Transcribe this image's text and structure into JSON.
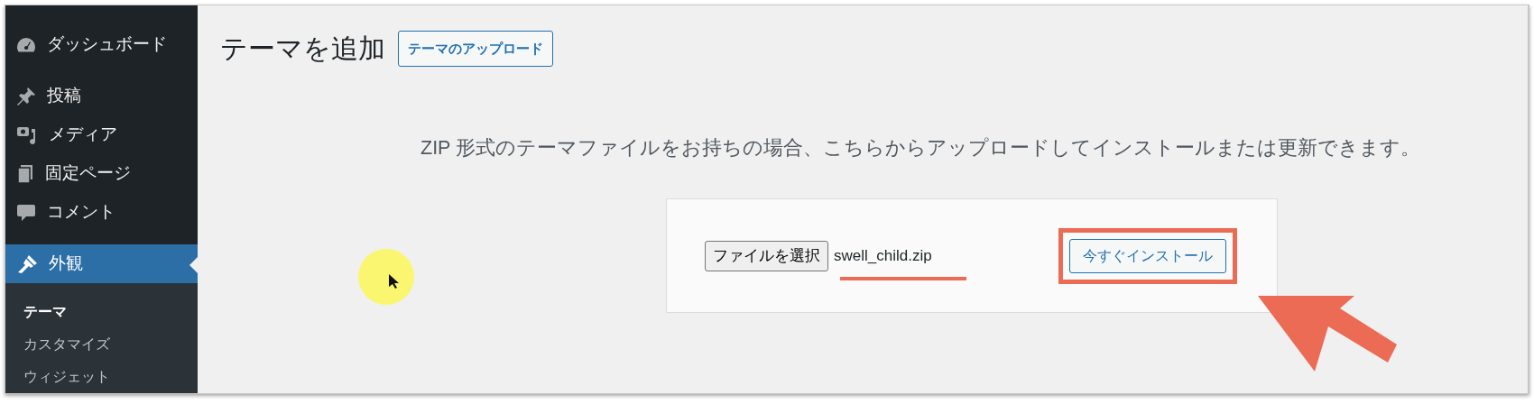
{
  "sidebar": {
    "items": [
      {
        "label": "ダッシュボード",
        "selected": false
      },
      {
        "label": "投稿",
        "selected": false
      },
      {
        "label": "メディア",
        "selected": false
      },
      {
        "label": "固定ページ",
        "selected": false
      },
      {
        "label": "コメント",
        "selected": false
      },
      {
        "label": "外観",
        "selected": true
      }
    ],
    "submenu": [
      {
        "label": "テーマ",
        "selected": true
      },
      {
        "label": "カスタマイズ",
        "selected": false
      },
      {
        "label": "ウィジェット",
        "selected": false
      }
    ]
  },
  "page": {
    "title": "テーマを追加",
    "upload_button": "テーマのアップロード",
    "description": "ZIP 形式のテーマファイルをお持ちの場合、こちらからアップロードしてインストールまたは更新できます。",
    "file_button": "ファイルを選択",
    "file_name": "swell_child.zip",
    "install_button": "今すぐインストール"
  }
}
